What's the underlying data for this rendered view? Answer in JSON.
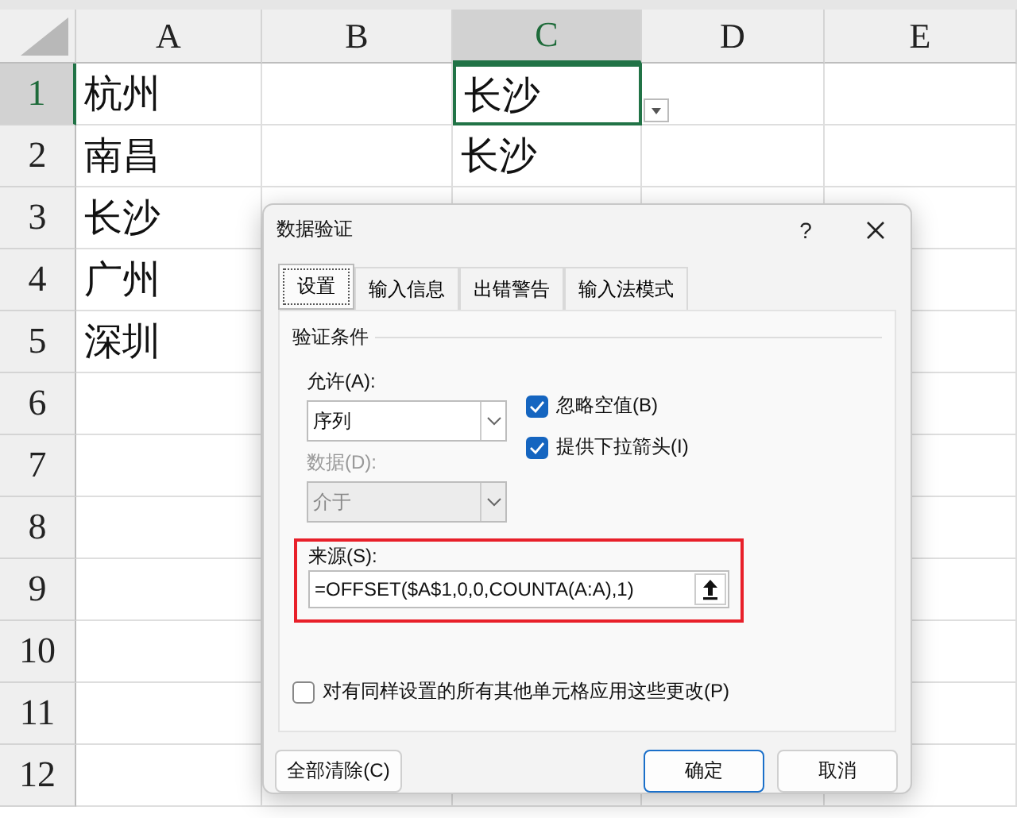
{
  "sheet": {
    "columns": [
      {
        "label": "A",
        "selected": false
      },
      {
        "label": "B",
        "selected": false
      },
      {
        "label": "C",
        "selected": true
      },
      {
        "label": "D",
        "selected": false
      },
      {
        "label": "E",
        "selected": false
      }
    ],
    "rows": [
      {
        "label": "1",
        "selected": true,
        "col_a": "杭州",
        "col_c": "长沙"
      },
      {
        "label": "2",
        "selected": false,
        "col_a": "南昌",
        "col_c": "长沙"
      },
      {
        "label": "3",
        "selected": false,
        "col_a": "长沙"
      },
      {
        "label": "4",
        "selected": false,
        "col_a": "广州"
      },
      {
        "label": "5",
        "selected": false,
        "col_a": "深圳"
      },
      {
        "label": "6",
        "selected": false
      },
      {
        "label": "7",
        "selected": false
      },
      {
        "label": "8",
        "selected": false
      },
      {
        "label": "9",
        "selected": false
      },
      {
        "label": "10",
        "selected": false
      },
      {
        "label": "11",
        "selected": false
      },
      {
        "label": "12",
        "selected": false
      }
    ]
  },
  "dialog": {
    "title": "数据验证",
    "help": "?",
    "tabs": [
      {
        "label": "设置",
        "selected": true
      },
      {
        "label": "输入信息",
        "selected": false
      },
      {
        "label": "出错警告",
        "selected": false
      },
      {
        "label": "输入法模式",
        "selected": false
      }
    ],
    "group_title": "验证条件",
    "allow": {
      "label": "允许(A):",
      "value": "序列",
      "disabled": false
    },
    "data": {
      "label": "数据(D):",
      "value": "介于",
      "disabled": true
    },
    "checkboxes": [
      {
        "label": "忽略空值(B)",
        "checked": true
      },
      {
        "label": "提供下拉箭头(I)",
        "checked": true
      }
    ],
    "source": {
      "label": "来源(S):",
      "value": "=OFFSET($A$1,0,0,COUNTA(A:A),1)",
      "highlighted": true
    },
    "apply_all": {
      "label": "对有同样设置的所有其他单元格应用这些更改(P)",
      "checked": false
    },
    "buttons": [
      {
        "label": "全部清除(C)",
        "kind": "left"
      },
      {
        "label": "确定",
        "kind": "default"
      },
      {
        "label": "取消",
        "kind": "normal"
      }
    ]
  }
}
